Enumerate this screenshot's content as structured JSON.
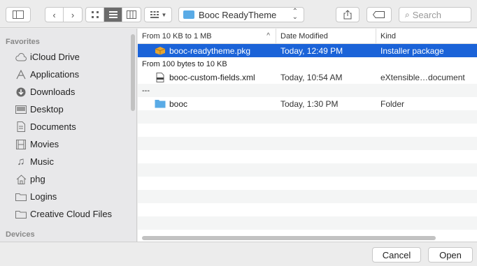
{
  "toolbar": {
    "path_label": "Booc ReadyTheme",
    "search_placeholder": "Search"
  },
  "sidebar": {
    "favorites_header": "Favorites",
    "devices_header": "Devices",
    "items": [
      {
        "label": "iCloud Drive",
        "icon": "cloud-icon"
      },
      {
        "label": "Applications",
        "icon": "applications-icon"
      },
      {
        "label": "Downloads",
        "icon": "downloads-icon"
      },
      {
        "label": "Desktop",
        "icon": "desktop-icon"
      },
      {
        "label": "Documents",
        "icon": "documents-icon"
      },
      {
        "label": "Movies",
        "icon": "movies-icon"
      },
      {
        "label": "Music",
        "icon": "music-icon"
      },
      {
        "label": "phg",
        "icon": "home-icon"
      },
      {
        "label": "Logins",
        "icon": "folder-icon"
      },
      {
        "label": "Creative Cloud Files",
        "icon": "folder-icon"
      }
    ]
  },
  "columns": {
    "name": "From 10 KB to 1 MB",
    "date": "Date Modified",
    "kind": "Kind"
  },
  "files": {
    "row1": {
      "name": "booc-readytheme.pkg",
      "date": "Today, 12:49 PM",
      "kind": "Installer package"
    },
    "group2": "From 100 bytes to 10 KB",
    "row2": {
      "name": "booc-custom-fields.xml",
      "date": "Today, 10:54 AM",
      "kind": "eXtensible…document"
    },
    "group3": "---",
    "row3": {
      "name": "booc",
      "date": "Today, 1:30 PM",
      "kind": "Folder"
    }
  },
  "footer": {
    "cancel": "Cancel",
    "open": "Open"
  },
  "colors": {
    "selection": "#1b63d8",
    "folder": "#5aabe6"
  }
}
